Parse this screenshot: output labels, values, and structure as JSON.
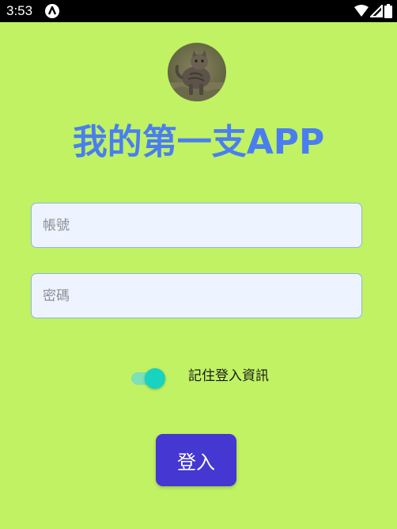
{
  "status_bar": {
    "time": "3:53",
    "app_icon": "a-letter-icon",
    "icons": [
      "wifi-icon",
      "signal-icon",
      "battery-icon"
    ]
  },
  "avatar": {
    "subject": "cat-photo"
  },
  "title": "我的第一支APP",
  "form": {
    "account": {
      "placeholder": "帳號",
      "value": ""
    },
    "password": {
      "placeholder": "密碼",
      "value": ""
    },
    "remember": {
      "label": "記住登入資訊",
      "checked": true
    },
    "login_label": "登入"
  },
  "colors": {
    "background": "#c0f263",
    "title": "#4a7ef0",
    "field_bg": "#eef4ff",
    "field_border": "#8fb4e8",
    "toggle_thumb": "#17d3c0",
    "toggle_track": "#7ee0b5",
    "button": "#4437d2"
  }
}
